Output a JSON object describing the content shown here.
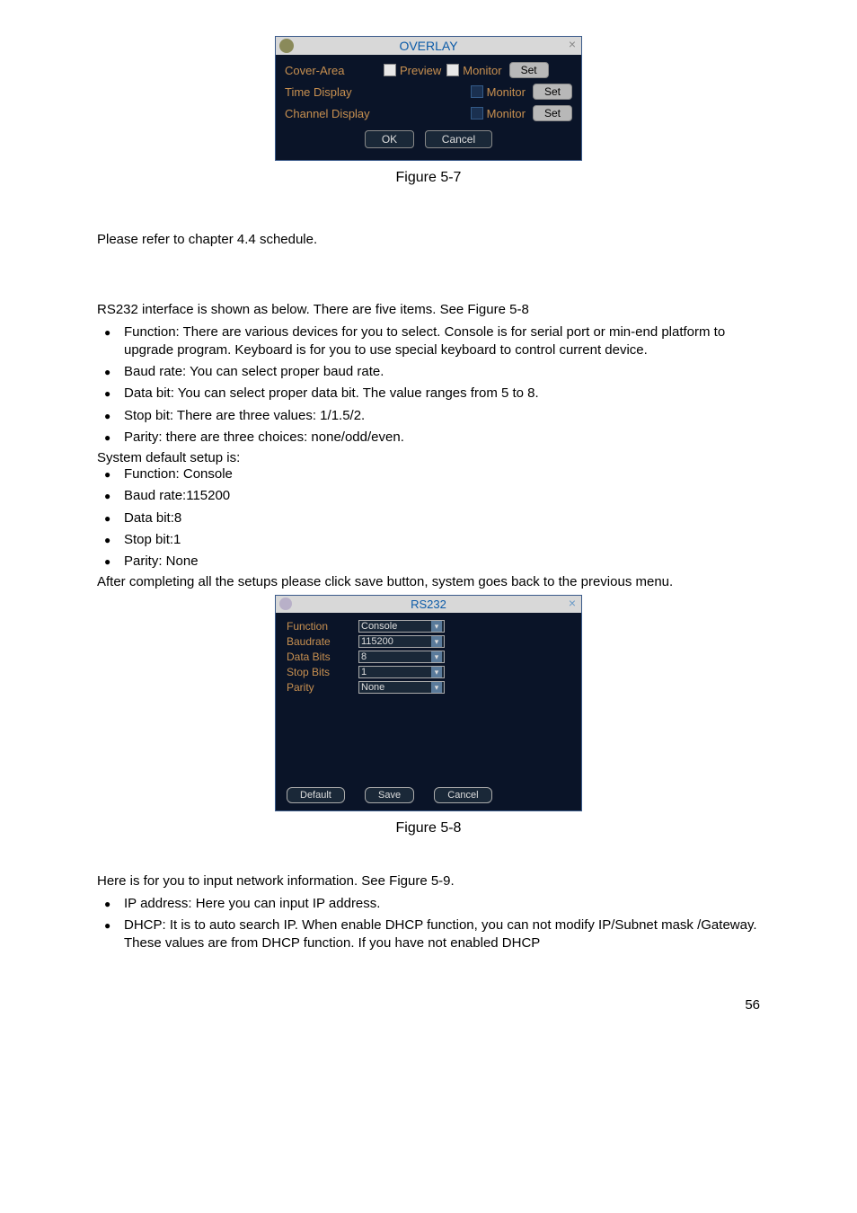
{
  "overlay_dialog": {
    "title": "OVERLAY",
    "close": "×",
    "rows": [
      {
        "label": "Cover-Area",
        "opt1": "Preview",
        "opt2": "Monitor",
        "btn": "Set"
      },
      {
        "label": "Time Display",
        "opt2": "Monitor",
        "btn": "Set"
      },
      {
        "label": "Channel Display",
        "opt2": "Monitor",
        "btn": "Set"
      }
    ],
    "ok": "OK",
    "cancel": "Cancel"
  },
  "fig57": "Figure 5-7",
  "p1": "Please refer to chapter 4.4 schedule.",
  "p2": "RS232 interface is shown as below. There are five items. See Figure 5-8",
  "bullets1": [
    "Function: There are various devices for you to select. Console is for serial port or min-end platform to upgrade program. Keyboard is for you to use special keyboard to control current device.",
    "Baud rate: You can select proper baud rate.",
    "Data bit: You can select proper data bit. The value ranges from 5 to 8.",
    "Stop bit: There are three values: 1/1.5/2.",
    "Parity: there are three choices: none/odd/even."
  ],
  "p3": "System default setup is:",
  "bullets2": [
    "Function: Console",
    "Baud rate:115200",
    "Data bit:8",
    "Stop bit:1",
    "Parity: None"
  ],
  "p4": "After completing all the setups please click save button, system goes back to the previous menu.",
  "rs232_dialog": {
    "title": "RS232",
    "close": "×",
    "fields": [
      {
        "label": "Function",
        "value": "Console"
      },
      {
        "label": "Baudrate",
        "value": "115200"
      },
      {
        "label": "Data Bits",
        "value": "8"
      },
      {
        "label": "Stop Bits",
        "value": "1"
      },
      {
        "label": "Parity",
        "value": "None"
      }
    ],
    "default": "Default",
    "save": "Save",
    "cancel": "Cancel"
  },
  "fig58": "Figure 5-8",
  "p5": "Here is for you to input network information. See Figure 5-9.",
  "bullets3": [
    "IP address: Here you can input IP address.",
    "DHCP: It is to auto search IP. When enable DHCP function, you can not modify IP/Subnet mask /Gateway. These values are from DHCP function. If you have not enabled DHCP"
  ],
  "pagenum": "56"
}
